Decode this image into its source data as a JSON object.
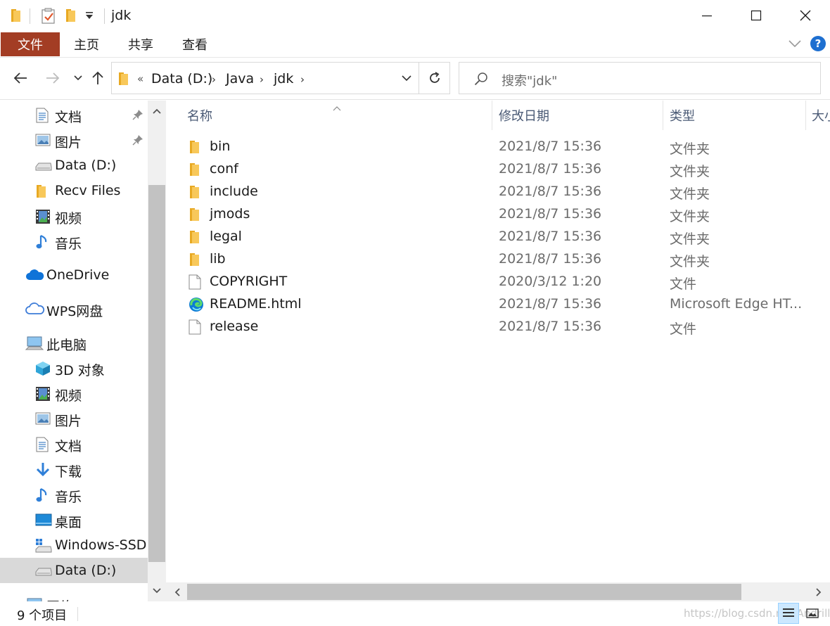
{
  "window": {
    "title": "jdk"
  },
  "ribbon": {
    "file_tab": "文件",
    "tabs": [
      "主页",
      "共享",
      "查看"
    ],
    "help": "?"
  },
  "address": {
    "overflow": "«",
    "crumbs": [
      "Data (D:)",
      "Java",
      "jdk"
    ]
  },
  "search": {
    "placeholder": "搜索\"jdk\""
  },
  "sidebar": {
    "items": [
      {
        "label": "文档",
        "icon": "document-icon",
        "pinned": true
      },
      {
        "label": "图片",
        "icon": "picture-icon",
        "pinned": true
      },
      {
        "label": "Data (D:)",
        "icon": "drive-icon"
      },
      {
        "label": "Recv Files",
        "icon": "folder-icon"
      },
      {
        "label": "视频",
        "icon": "video-icon"
      },
      {
        "label": "音乐",
        "icon": "music-icon"
      },
      {
        "label": "OneDrive",
        "icon": "onedrive-cloud-icon"
      },
      {
        "label": "WPS网盘",
        "icon": "wps-cloud-icon"
      },
      {
        "label": "此电脑",
        "icon": "this-pc-icon"
      },
      {
        "label": "3D 对象",
        "icon": "3d-objects-icon"
      },
      {
        "label": "视频",
        "icon": "video-icon"
      },
      {
        "label": "图片",
        "icon": "picture-icon"
      },
      {
        "label": "文档",
        "icon": "document-icon"
      },
      {
        "label": "下载",
        "icon": "download-icon"
      },
      {
        "label": "音乐",
        "icon": "music-icon"
      },
      {
        "label": "桌面",
        "icon": "desktop-icon"
      },
      {
        "label": "Windows-SSD (",
        "icon": "windows-drive-icon"
      },
      {
        "label": "Data (D:)",
        "icon": "drive-icon",
        "selected": true
      },
      {
        "label": "网络",
        "icon": "network-icon"
      }
    ]
  },
  "columns": {
    "name": "名称",
    "date": "修改日期",
    "type": "类型",
    "size": "大小"
  },
  "files": [
    {
      "name": "bin",
      "date": "2021/8/7 15:36",
      "type": "文件夹",
      "icon": "folder-icon"
    },
    {
      "name": "conf",
      "date": "2021/8/7 15:36",
      "type": "文件夹",
      "icon": "folder-icon"
    },
    {
      "name": "include",
      "date": "2021/8/7 15:36",
      "type": "文件夹",
      "icon": "folder-icon"
    },
    {
      "name": "jmods",
      "date": "2021/8/7 15:36",
      "type": "文件夹",
      "icon": "folder-icon"
    },
    {
      "name": "legal",
      "date": "2021/8/7 15:36",
      "type": "文件夹",
      "icon": "folder-icon"
    },
    {
      "name": "lib",
      "date": "2021/8/7 15:36",
      "type": "文件夹",
      "icon": "folder-icon"
    },
    {
      "name": "COPYRIGHT",
      "date": "2020/3/12 1:20",
      "type": "文件",
      "icon": "file-icon"
    },
    {
      "name": "README.html",
      "date": "2021/8/7 15:36",
      "type": "Microsoft Edge HT...",
      "icon": "edge-icon"
    },
    {
      "name": "release",
      "date": "2021/8/7 15:36",
      "type": "文件",
      "icon": "file-icon"
    }
  ],
  "status": {
    "count": "9 个项目",
    "watermark": "https://blog.csdn.net/Andrill"
  },
  "colors": {
    "file_tab_bg": "#a33d24",
    "folder_yellow": "#f8c85a",
    "selected_bg": "#d9d9d9",
    "accent_blue": "#1e6fd0"
  }
}
